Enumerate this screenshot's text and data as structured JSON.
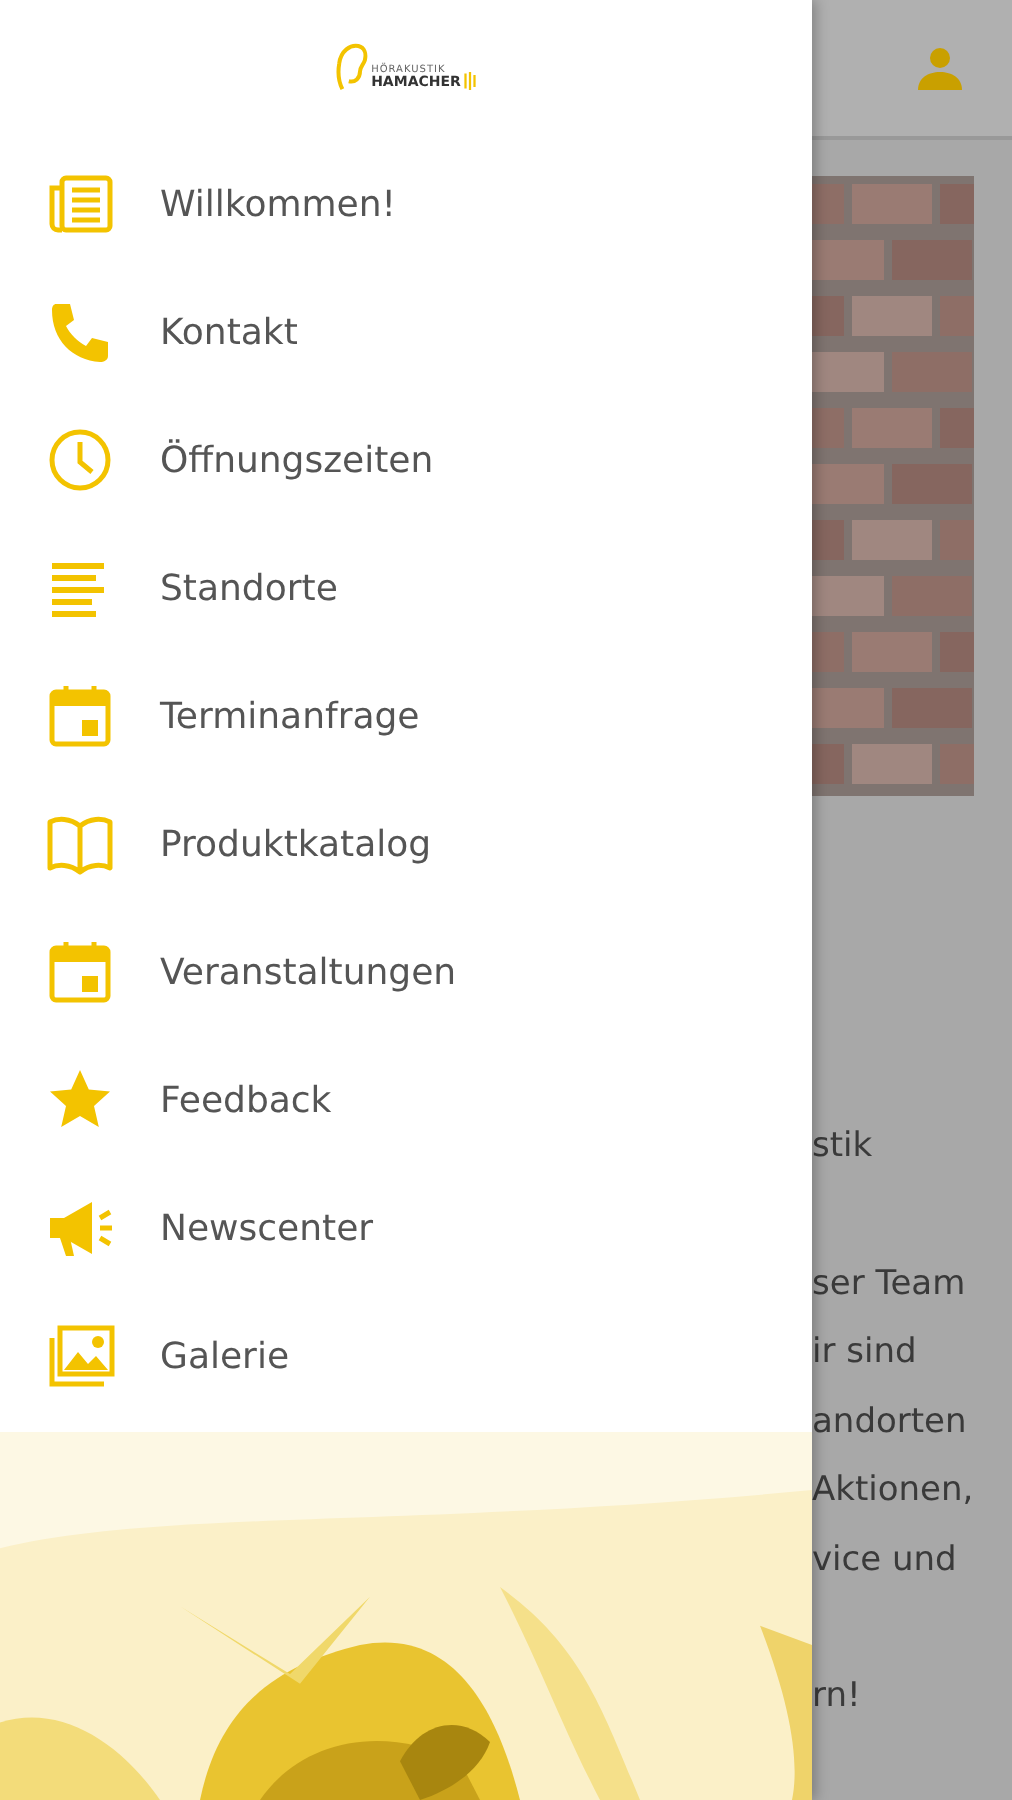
{
  "logo": {
    "line_1": "HÖRAKUSTIK",
    "line_2": "HAMACHER"
  },
  "menu": [
    {
      "label": "Willkommen!"
    },
    {
      "label": "Kontakt"
    },
    {
      "label": "Öffnungszeiten"
    },
    {
      "label": "Standorte"
    },
    {
      "label": "Terminanfrage"
    },
    {
      "label": "Produktkatalog"
    },
    {
      "label": "Veranstaltungen"
    },
    {
      "label": "Feedback"
    },
    {
      "label": "Newscenter"
    },
    {
      "label": "Galerie"
    }
  ],
  "background_page": {
    "paragraphs": [
      [
        "stik"
      ],
      [
        "ser Team",
        "ir sind",
        "andorten",
        "Aktionen,",
        "vice und"
      ],
      [
        "rn!"
      ]
    ]
  }
}
